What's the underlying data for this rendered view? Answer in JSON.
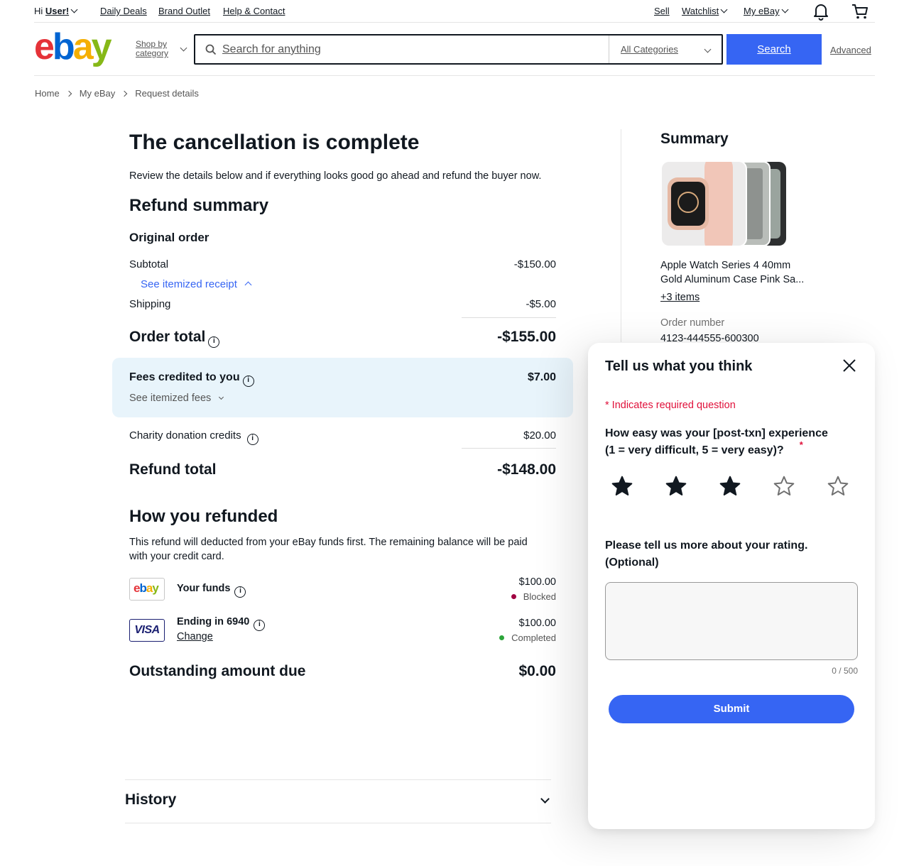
{
  "topnav": {
    "greeting_prefix": "Hi",
    "user_name": "User!",
    "daily_deals": "Daily Deals",
    "brand_outlet": "Brand Outlet",
    "help_contact": "Help & Contact",
    "sell": "Sell",
    "watchlist": "Watchlist",
    "my_ebay": "My eBay"
  },
  "header": {
    "logo_letters": [
      "e",
      "b",
      "a",
      "y"
    ],
    "shop_by_line1": "Shop by",
    "shop_by_line2": "category",
    "search_placeholder": "Search for anything",
    "category_selected": "All Categories",
    "search_button": "Search",
    "advanced": "Advanced"
  },
  "breadcrumb": [
    "Home",
    "My eBay",
    "Request details"
  ],
  "main": {
    "title": "The cancellation is complete",
    "intro": "Review the details below and if everything looks good go ahead and refund the buyer now.",
    "refund_summary_heading": "Refund summary",
    "original_order_heading": "Original order",
    "subtotal_label": "Subtotal",
    "subtotal_value": "-$150.00",
    "itemized_receipt_link": "See itemized receipt",
    "shipping_label": "Shipping",
    "shipping_value": "-$5.00",
    "order_total_label": "Order total",
    "order_total_value": "-$155.00",
    "fees_label": "Fees credited to you",
    "fees_value": "$7.00",
    "itemized_fees_link": "See itemized fees",
    "charity_label": "Charity donation credits",
    "charity_value": "$20.00",
    "refund_total_label": "Refund total",
    "refund_total_value": "-$148.00",
    "how_refunded_heading": "How you refunded",
    "how_refunded_text": "This refund will deducted from your eBay funds first. The remaining balance will be paid with your credit card.",
    "payments": [
      {
        "label": "Your funds",
        "amount": "$100.00",
        "status": "Blocked",
        "status_color": "#a00041",
        "icon": "ebay-logo-icon"
      },
      {
        "label": "Ending in 6940",
        "link": "Change",
        "amount": "$100.00",
        "status": "Completed",
        "status_color": "#2ca53a",
        "icon": "visa-icon",
        "icon_text": "VISA"
      }
    ],
    "outstanding_label": "Outstanding amount due",
    "outstanding_value": "$0.00",
    "history_label": "History"
  },
  "summary": {
    "heading": "Summary",
    "item_title_line1": "Apple Watch Series 4 40mm",
    "item_title_line2": "Gold Aluminum Case Pink Sa...",
    "more_items_link": "+3 items",
    "order_number_label": "Order number",
    "order_number_value": "4123-444555-600300"
  },
  "feedback": {
    "title": "Tell us what you think",
    "required_note": "* Indicates required question",
    "question_line1": "How easy was your [post-txn] experience",
    "question_line2": "(1 = very difficult,  5 = very easy)?",
    "required_marker": "*",
    "rating": 3,
    "rating_max": 5,
    "followup_line1": "Please tell us more about your rating.",
    "followup_line2": "(Optional)",
    "comment_value": "",
    "counter": "0 / 500",
    "submit_label": "Submit"
  },
  "colors": {
    "accent_blue": "#3665f3",
    "link_blue": "#3665f3",
    "required_red": "#e0103a",
    "fees_bg": "#e8f4fb"
  }
}
